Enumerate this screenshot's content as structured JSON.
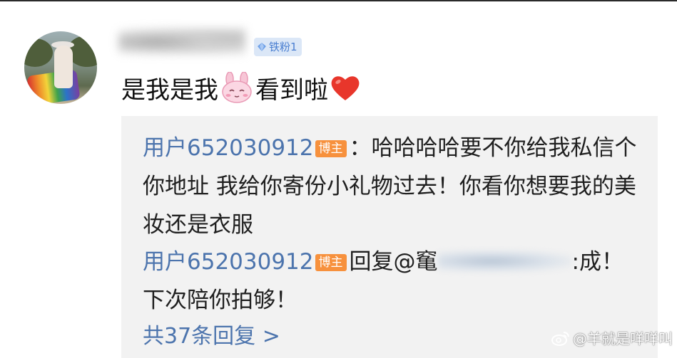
{
  "comment": {
    "badge_label": "铁粉1",
    "text_part1": "是我是我",
    "text_part2": "看到啦",
    "emoji_1": "bunny-face",
    "emoji_2": "red-heart"
  },
  "replies": [
    {
      "user": "用户652030912",
      "tag": "博主",
      "text": "：哈哈哈哈要不你给我私信个你地址 我给你寄份小礼物过去！你看你想要我的美妆还是衣服"
    },
    {
      "user": "用户652030912",
      "tag": "博主",
      "text_prefix": "回复@䆴",
      "text_suffix": ":成！下次陪你拍够！"
    }
  ],
  "more_replies": "共37条回复 >",
  "watermark": "@羊就是咩咩叫",
  "colors": {
    "link_blue": "#4c74ad",
    "tag_orange": "#f7913d",
    "badge_bg": "#dbe7f7",
    "reply_bg": "#f2f2f2"
  }
}
